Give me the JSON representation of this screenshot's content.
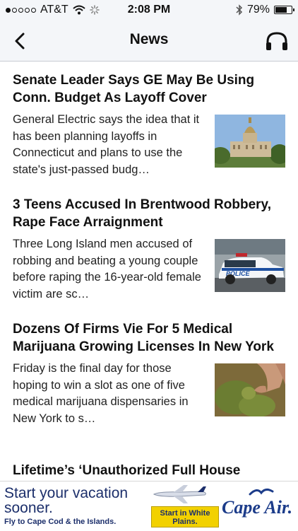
{
  "status": {
    "carrier": "AT&T",
    "time": "2:08 PM",
    "battery_text": "79%",
    "battery_level": 0.79,
    "signal_bars_filled": 1,
    "signal_bars_total": 5
  },
  "nav": {
    "title": "News",
    "back_icon": "chevron-left-icon",
    "audio_icon": "headphones-icon"
  },
  "articles": [
    {
      "headline": "Senate Leader Says GE May Be Using Conn. Budget As Layoff Cover",
      "summary": "General Electric says the idea that it has been planning layoffs in Connecticut and plans to use the state's just-passed budg…",
      "thumbnail": "capitol-building"
    },
    {
      "headline": "3 Teens Accused In Brentwood Robbery, Rape Face Arraignment",
      "summary": "Three Long Island men accused of robbing and beating a young couple before raping the 16-year-old female victim are sc…",
      "thumbnail": "police-car",
      "thumbnail_text": "POLICE"
    },
    {
      "headline": "Dozens Of Firms Vie For 5 Medical Marijuana Growing Licenses In New York",
      "summary": "Friday is the final day for those hoping to win a slot as one of five medical marijuana dispensaries in New York to s…",
      "thumbnail": "marijuana-buds"
    },
    {
      "headline": "Lifetime’s ‘Unauthorized Full House"
    }
  ],
  "ad": {
    "headline": "Start your vacation sooner.",
    "subtext": "Fly to Cape Cod & the Islands.",
    "cta": "Start in White Plains.",
    "logo": "Cape Air."
  },
  "colors": {
    "bar_background": "#f4f6f9",
    "ad_navy": "#1c2f6b",
    "ad_yellow": "#f2d100"
  }
}
